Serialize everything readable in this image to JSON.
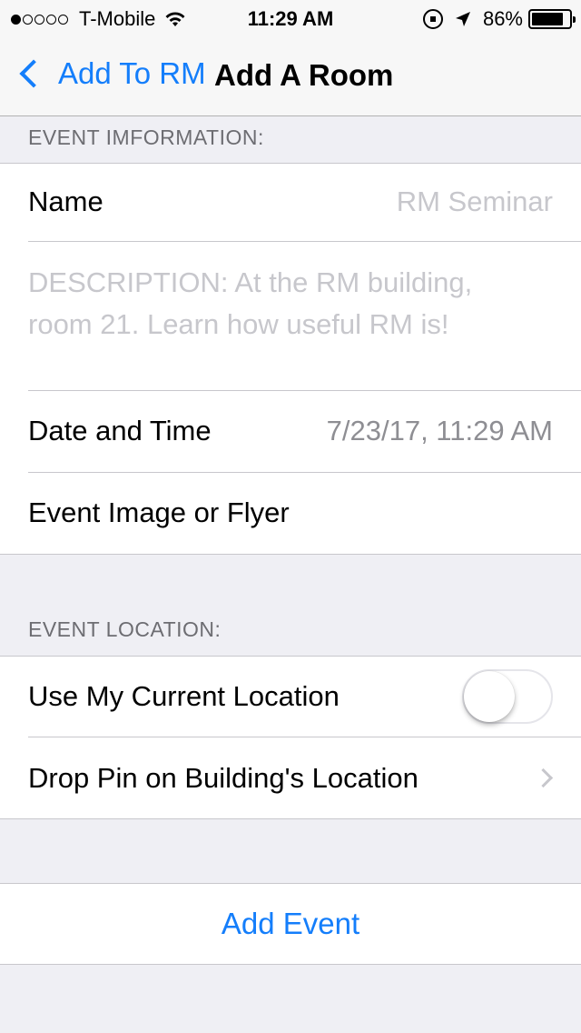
{
  "status_bar": {
    "signal_bars": 5,
    "signal_filled": 1,
    "carrier": "T-Mobile",
    "time": "11:29 AM",
    "battery_percent": "86%",
    "battery_level": 0.86
  },
  "navbar": {
    "back_label": "Add To RM",
    "title": "Add A Room"
  },
  "event_info": {
    "header": "EVENT IMFORMATION:",
    "name_label": "Name",
    "name_placeholder": "RM Seminar",
    "description_placeholder": "DESCRIPTION: At the RM building, room 21. Learn how useful RM is!",
    "date_label": "Date and Time",
    "date_value": "7/23/17, 11:29 AM",
    "image_label": "Event Image or Flyer"
  },
  "event_location": {
    "header": "EVENT LOCATION:",
    "current_location_label": "Use My Current Location",
    "current_location_on": false,
    "drop_pin_label": "Drop Pin on Building's Location"
  },
  "actions": {
    "add_event_label": "Add Event"
  },
  "colors": {
    "accent": "#147efb",
    "background": "#efeff4",
    "placeholder": "#c7c7cc"
  }
}
